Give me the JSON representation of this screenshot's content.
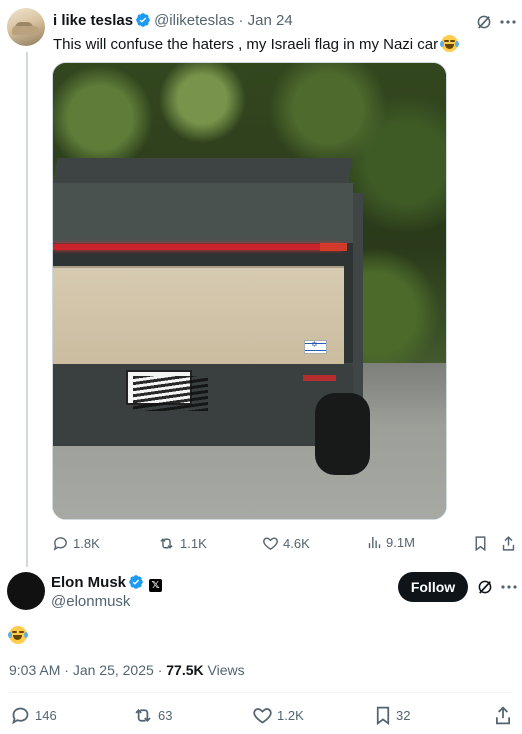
{
  "quoted_tweet": {
    "name": "i like teslas",
    "handle": "@iliketeslas",
    "separator": "·",
    "date": "Jan 24",
    "text": "This will confuse the haters , my Israeli flag in my Nazi car",
    "stats": {
      "replies": "1.8K",
      "reposts": "1.1K",
      "likes": "4.6K",
      "views": "9.1M"
    }
  },
  "main_tweet": {
    "name": "Elon Musk",
    "affiliate_badge": "𝕏",
    "handle": "@elonmusk",
    "follow_label": "Follow",
    "time": "9:03 AM",
    "date_sep": "·",
    "date": "Jan 25, 2025",
    "views_sep": "·",
    "views_count": "77.5K",
    "views_label": "Views",
    "stats": {
      "replies": "146",
      "reposts": "63",
      "likes": "1.2K",
      "bookmarks": "32"
    }
  },
  "colors": {
    "verified": "#1d9bf0",
    "muted": "#536471",
    "text": "#0f1419"
  }
}
